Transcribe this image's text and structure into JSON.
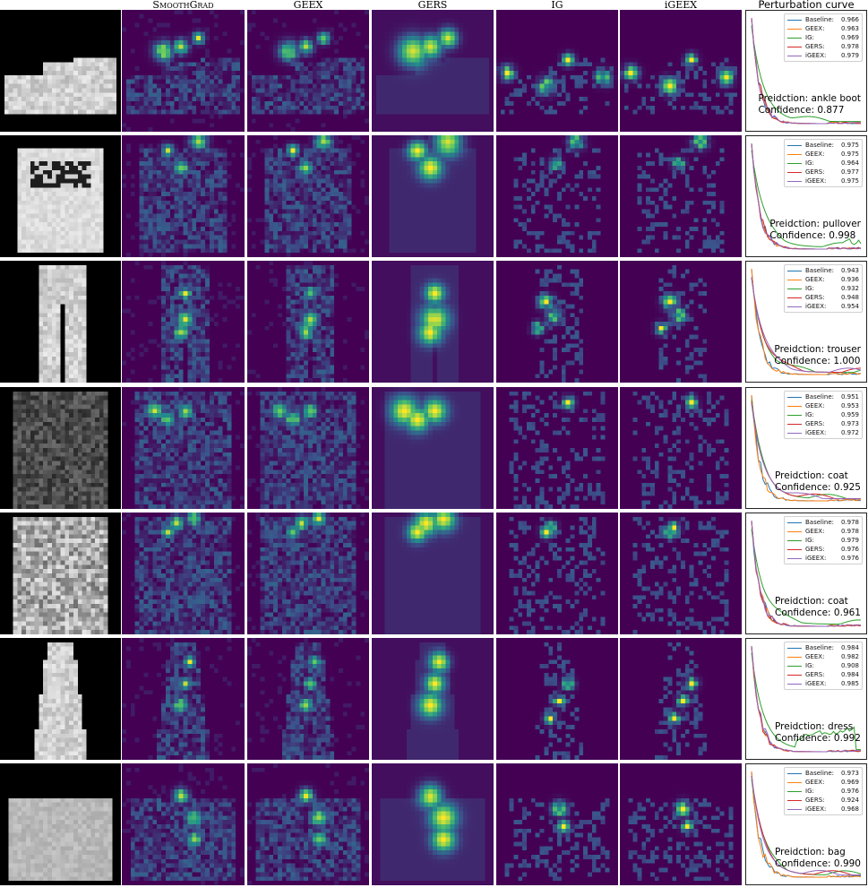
{
  "columns": [
    "SmoothGrad",
    "GEEX",
    "GERS",
    "IG",
    "iGEEX",
    "Perturbation curve"
  ],
  "series_colors": {
    "Baseline": "#1f77b4",
    "GEEX": "#ff7f0e",
    "IG": "#2ca02c",
    "GERS": "#d62728",
    "iGEEX": "#9467bd"
  },
  "legend_names": [
    "Baseline:",
    "GEEX:",
    "IG:",
    "GERS:",
    "iGEEX:"
  ],
  "prediction_prefix": "Preidction: ",
  "confidence_prefix": "Confidence: ",
  "rows": [
    {
      "item": "ankle-boot",
      "prediction": "ankle boot",
      "confidence": "0.877",
      "scores": [
        "0.966",
        "0.963",
        "0.969",
        "0.978",
        "0.979"
      ]
    },
    {
      "item": "pullover",
      "prediction": "pullover",
      "confidence": "0.998",
      "scores": [
        "0.975",
        "0.975",
        "0.964",
        "0.977",
        "0.975"
      ]
    },
    {
      "item": "trouser",
      "prediction": "trouser",
      "confidence": "1.000",
      "scores": [
        "0.943",
        "0.936",
        "0.932",
        "0.948",
        "0.954"
      ]
    },
    {
      "item": "coat",
      "prediction": "coat",
      "confidence": "0.925",
      "scores": [
        "0.951",
        "0.953",
        "0.959",
        "0.973",
        "0.972"
      ]
    },
    {
      "item": "coat",
      "prediction": "coat",
      "confidence": "0.961",
      "scores": [
        "0.978",
        "0.978",
        "0.979",
        "0.976",
        "0.976"
      ]
    },
    {
      "item": "dress",
      "prediction": "dress",
      "confidence": "0.992",
      "scores": [
        "0.984",
        "0.982",
        "0.908",
        "0.984",
        "0.985"
      ]
    },
    {
      "item": "bag",
      "prediction": "bag",
      "confidence": "0.990",
      "scores": [
        "0.973",
        "0.969",
        "0.976",
        "0.924",
        "0.968"
      ]
    }
  ]
}
